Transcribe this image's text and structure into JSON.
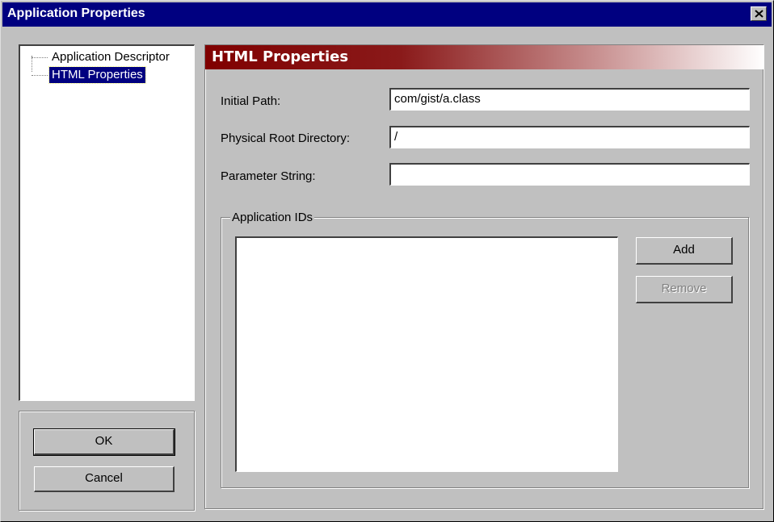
{
  "window": {
    "title": "Application Properties",
    "close_icon": "close-icon"
  },
  "tree": {
    "items": [
      {
        "label": "Application Descriptor",
        "selected": false
      },
      {
        "label": "HTML Properties",
        "selected": true
      }
    ]
  },
  "buttons": {
    "ok_label": "OK",
    "cancel_label": "Cancel",
    "add_label": "Add",
    "remove_label": "Remove"
  },
  "panel": {
    "header": "HTML Properties",
    "header_colors": [
      "#800000",
      "#ffffff"
    ],
    "fields": {
      "initial_path": {
        "label": "Initial Path:",
        "value": "com/gist/a.class"
      },
      "physical_root": {
        "label": "Physical Root Directory:",
        "value": "/"
      },
      "parameter_string": {
        "label": "Parameter String:",
        "value": ""
      }
    },
    "app_ids": {
      "title": "Application IDs",
      "items": []
    }
  }
}
